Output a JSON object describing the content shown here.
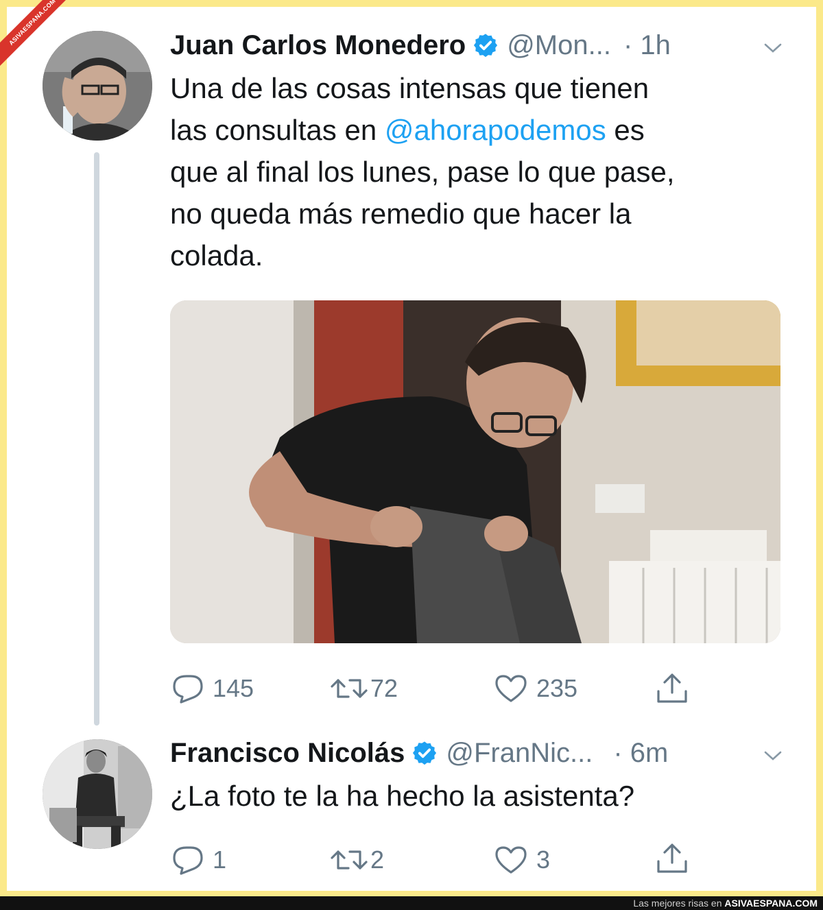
{
  "watermark": {
    "ribbon_text": "ASIVAESPANA.COM"
  },
  "tweets": [
    {
      "author_name": "Juan Carlos Monedero",
      "handle": "@Mon...",
      "time": "· 1h",
      "text_before_mention": "Una de las cosas intensas que tienen\nlas consultas en ",
      "mention": "@ahorapodemos",
      "text_after_mention": " es\nque al final los lunes, pase lo que pase,\nno queda más remedio que hacer la\ncolada.",
      "has_photo": true,
      "replies": "145",
      "retweets": "72",
      "likes": "235"
    },
    {
      "author_name": "Francisco Nicolás",
      "handle": "@FranNic...",
      "time": "· 6m",
      "text": "¿La foto te la ha hecho la asistenta?",
      "replies": "1",
      "retweets": "2",
      "likes": "3"
    }
  ],
  "footer": {
    "prefix": "Las mejores risas en ",
    "site": "ASIVAESPANA.COM"
  },
  "colors": {
    "accent": "#1da1f2",
    "muted": "#657786",
    "frame": "#fbe98a",
    "ribbon": "#d9342b"
  },
  "icons": [
    "verified-badge-icon",
    "chevron-down-icon",
    "reply-icon",
    "retweet-icon",
    "like-icon",
    "share-icon"
  ]
}
